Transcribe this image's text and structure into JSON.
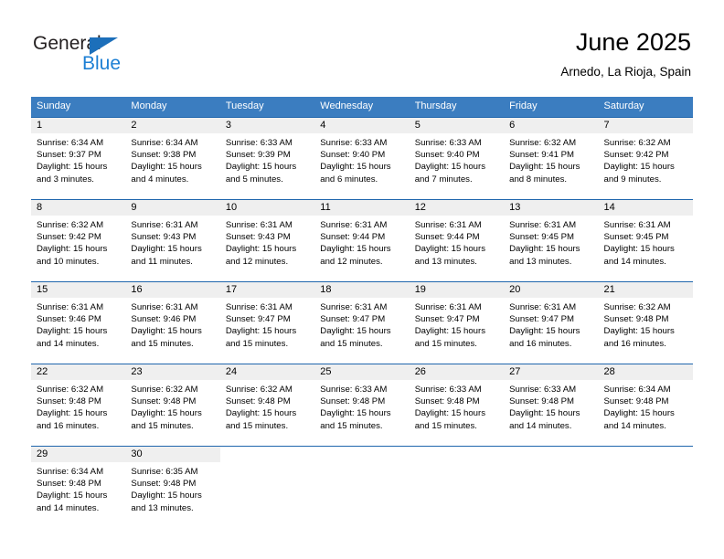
{
  "brand": {
    "name_part1": "General",
    "name_part2": "Blue",
    "colors": {
      "triangle": "#1c6fba",
      "blue_text": "#1c7fd4",
      "header_band": "#3b7dc0",
      "row_divider": "#1f66ad",
      "daynum_band": "#efefef"
    }
  },
  "header": {
    "title": "June 2025",
    "subtitle": "Arnedo, La Rioja, Spain"
  },
  "weekday_headers": [
    "Sunday",
    "Monday",
    "Tuesday",
    "Wednesday",
    "Thursday",
    "Friday",
    "Saturday"
  ],
  "weeks": [
    [
      {
        "day": "1",
        "sunrise": "Sunrise: 6:34 AM",
        "sunset": "Sunset: 9:37 PM",
        "daylight_1": "Daylight: 15 hours",
        "daylight_2": "and 3 minutes."
      },
      {
        "day": "2",
        "sunrise": "Sunrise: 6:34 AM",
        "sunset": "Sunset: 9:38 PM",
        "daylight_1": "Daylight: 15 hours",
        "daylight_2": "and 4 minutes."
      },
      {
        "day": "3",
        "sunrise": "Sunrise: 6:33 AM",
        "sunset": "Sunset: 9:39 PM",
        "daylight_1": "Daylight: 15 hours",
        "daylight_2": "and 5 minutes."
      },
      {
        "day": "4",
        "sunrise": "Sunrise: 6:33 AM",
        "sunset": "Sunset: 9:40 PM",
        "daylight_1": "Daylight: 15 hours",
        "daylight_2": "and 6 minutes."
      },
      {
        "day": "5",
        "sunrise": "Sunrise: 6:33 AM",
        "sunset": "Sunset: 9:40 PM",
        "daylight_1": "Daylight: 15 hours",
        "daylight_2": "and 7 minutes."
      },
      {
        "day": "6",
        "sunrise": "Sunrise: 6:32 AM",
        "sunset": "Sunset: 9:41 PM",
        "daylight_1": "Daylight: 15 hours",
        "daylight_2": "and 8 minutes."
      },
      {
        "day": "7",
        "sunrise": "Sunrise: 6:32 AM",
        "sunset": "Sunset: 9:42 PM",
        "daylight_1": "Daylight: 15 hours",
        "daylight_2": "and 9 minutes."
      }
    ],
    [
      {
        "day": "8",
        "sunrise": "Sunrise: 6:32 AM",
        "sunset": "Sunset: 9:42 PM",
        "daylight_1": "Daylight: 15 hours",
        "daylight_2": "and 10 minutes."
      },
      {
        "day": "9",
        "sunrise": "Sunrise: 6:31 AM",
        "sunset": "Sunset: 9:43 PM",
        "daylight_1": "Daylight: 15 hours",
        "daylight_2": "and 11 minutes."
      },
      {
        "day": "10",
        "sunrise": "Sunrise: 6:31 AM",
        "sunset": "Sunset: 9:43 PM",
        "daylight_1": "Daylight: 15 hours",
        "daylight_2": "and 12 minutes."
      },
      {
        "day": "11",
        "sunrise": "Sunrise: 6:31 AM",
        "sunset": "Sunset: 9:44 PM",
        "daylight_1": "Daylight: 15 hours",
        "daylight_2": "and 12 minutes."
      },
      {
        "day": "12",
        "sunrise": "Sunrise: 6:31 AM",
        "sunset": "Sunset: 9:44 PM",
        "daylight_1": "Daylight: 15 hours",
        "daylight_2": "and 13 minutes."
      },
      {
        "day": "13",
        "sunrise": "Sunrise: 6:31 AM",
        "sunset": "Sunset: 9:45 PM",
        "daylight_1": "Daylight: 15 hours",
        "daylight_2": "and 13 minutes."
      },
      {
        "day": "14",
        "sunrise": "Sunrise: 6:31 AM",
        "sunset": "Sunset: 9:45 PM",
        "daylight_1": "Daylight: 15 hours",
        "daylight_2": "and 14 minutes."
      }
    ],
    [
      {
        "day": "15",
        "sunrise": "Sunrise: 6:31 AM",
        "sunset": "Sunset: 9:46 PM",
        "daylight_1": "Daylight: 15 hours",
        "daylight_2": "and 14 minutes."
      },
      {
        "day": "16",
        "sunrise": "Sunrise: 6:31 AM",
        "sunset": "Sunset: 9:46 PM",
        "daylight_1": "Daylight: 15 hours",
        "daylight_2": "and 15 minutes."
      },
      {
        "day": "17",
        "sunrise": "Sunrise: 6:31 AM",
        "sunset": "Sunset: 9:47 PM",
        "daylight_1": "Daylight: 15 hours",
        "daylight_2": "and 15 minutes."
      },
      {
        "day": "18",
        "sunrise": "Sunrise: 6:31 AM",
        "sunset": "Sunset: 9:47 PM",
        "daylight_1": "Daylight: 15 hours",
        "daylight_2": "and 15 minutes."
      },
      {
        "day": "19",
        "sunrise": "Sunrise: 6:31 AM",
        "sunset": "Sunset: 9:47 PM",
        "daylight_1": "Daylight: 15 hours",
        "daylight_2": "and 15 minutes."
      },
      {
        "day": "20",
        "sunrise": "Sunrise: 6:31 AM",
        "sunset": "Sunset: 9:47 PM",
        "daylight_1": "Daylight: 15 hours",
        "daylight_2": "and 16 minutes."
      },
      {
        "day": "21",
        "sunrise": "Sunrise: 6:32 AM",
        "sunset": "Sunset: 9:48 PM",
        "daylight_1": "Daylight: 15 hours",
        "daylight_2": "and 16 minutes."
      }
    ],
    [
      {
        "day": "22",
        "sunrise": "Sunrise: 6:32 AM",
        "sunset": "Sunset: 9:48 PM",
        "daylight_1": "Daylight: 15 hours",
        "daylight_2": "and 16 minutes."
      },
      {
        "day": "23",
        "sunrise": "Sunrise: 6:32 AM",
        "sunset": "Sunset: 9:48 PM",
        "daylight_1": "Daylight: 15 hours",
        "daylight_2": "and 15 minutes."
      },
      {
        "day": "24",
        "sunrise": "Sunrise: 6:32 AM",
        "sunset": "Sunset: 9:48 PM",
        "daylight_1": "Daylight: 15 hours",
        "daylight_2": "and 15 minutes."
      },
      {
        "day": "25",
        "sunrise": "Sunrise: 6:33 AM",
        "sunset": "Sunset: 9:48 PM",
        "daylight_1": "Daylight: 15 hours",
        "daylight_2": "and 15 minutes."
      },
      {
        "day": "26",
        "sunrise": "Sunrise: 6:33 AM",
        "sunset": "Sunset: 9:48 PM",
        "daylight_1": "Daylight: 15 hours",
        "daylight_2": "and 15 minutes."
      },
      {
        "day": "27",
        "sunrise": "Sunrise: 6:33 AM",
        "sunset": "Sunset: 9:48 PM",
        "daylight_1": "Daylight: 15 hours",
        "daylight_2": "and 14 minutes."
      },
      {
        "day": "28",
        "sunrise": "Sunrise: 6:34 AM",
        "sunset": "Sunset: 9:48 PM",
        "daylight_1": "Daylight: 15 hours",
        "daylight_2": "and 14 minutes."
      }
    ],
    [
      {
        "day": "29",
        "sunrise": "Sunrise: 6:34 AM",
        "sunset": "Sunset: 9:48 PM",
        "daylight_1": "Daylight: 15 hours",
        "daylight_2": "and 14 minutes."
      },
      {
        "day": "30",
        "sunrise": "Sunrise: 6:35 AM",
        "sunset": "Sunset: 9:48 PM",
        "daylight_1": "Daylight: 15 hours",
        "daylight_2": "and 13 minutes."
      },
      {
        "day": "",
        "sunrise": "",
        "sunset": "",
        "daylight_1": "",
        "daylight_2": ""
      },
      {
        "day": "",
        "sunrise": "",
        "sunset": "",
        "daylight_1": "",
        "daylight_2": ""
      },
      {
        "day": "",
        "sunrise": "",
        "sunset": "",
        "daylight_1": "",
        "daylight_2": ""
      },
      {
        "day": "",
        "sunrise": "",
        "sunset": "",
        "daylight_1": "",
        "daylight_2": ""
      },
      {
        "day": "",
        "sunrise": "",
        "sunset": "",
        "daylight_1": "",
        "daylight_2": ""
      }
    ]
  ]
}
